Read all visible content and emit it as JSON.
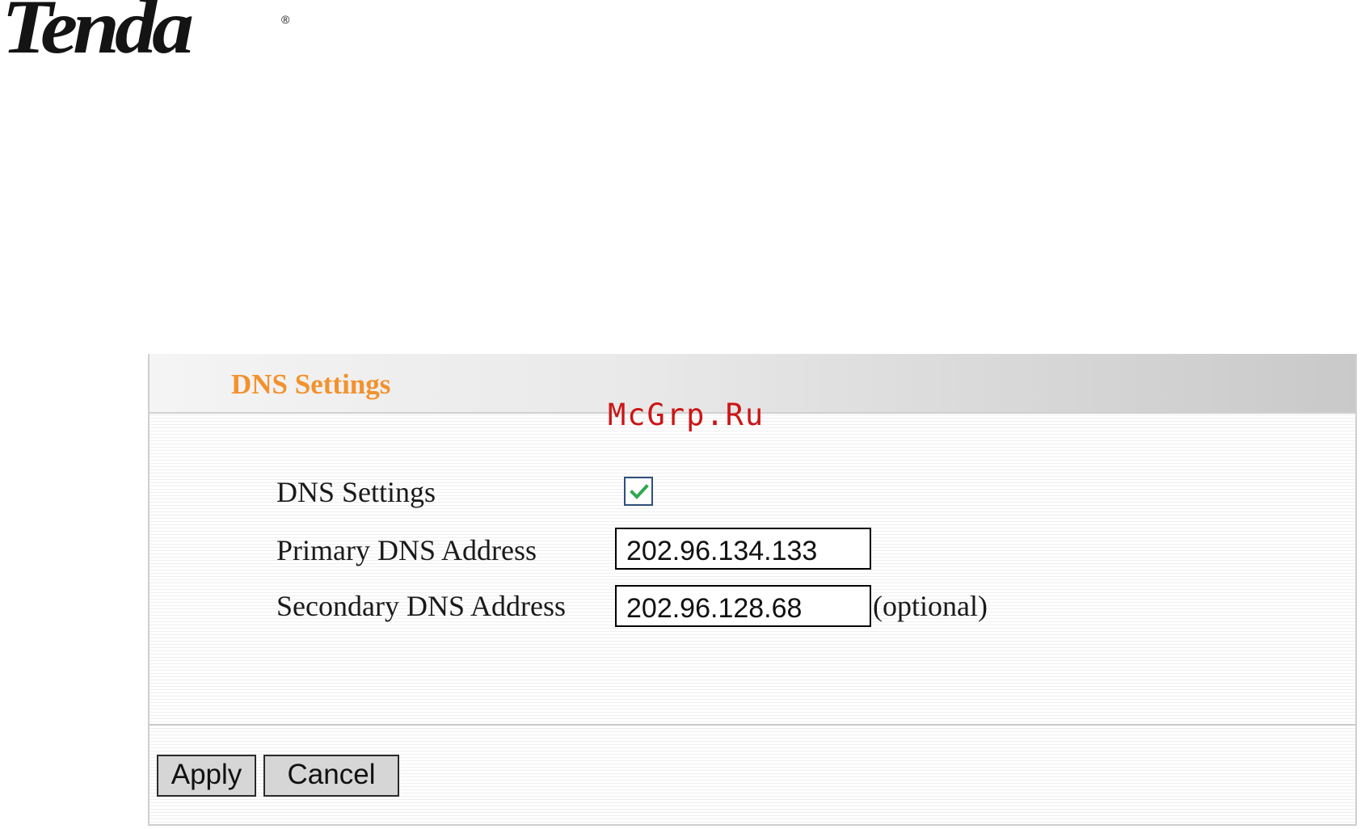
{
  "logo": {
    "text": "Tenda",
    "registered": "®"
  },
  "watermark": "McGrp.Ru",
  "panel": {
    "title": "DNS Settings",
    "rows": [
      {
        "label": "DNS Settings",
        "type": "checkbox",
        "checked": true
      },
      {
        "label": "Primary DNS Address",
        "type": "text",
        "value": "202.96.134.133"
      },
      {
        "label": "Secondary DNS Address",
        "type": "text",
        "value": "202.96.128.68",
        "suffix": "(optional)"
      }
    ]
  },
  "buttons": {
    "apply": "Apply",
    "cancel": "Cancel"
  },
  "colors": {
    "title": "#f2922e",
    "watermark": "#cc1515",
    "checkmark": "#2fa84f"
  }
}
